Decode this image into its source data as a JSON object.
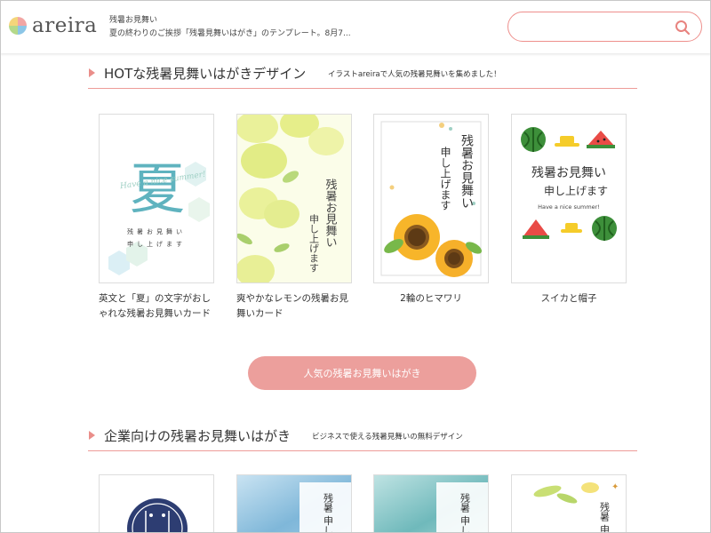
{
  "header": {
    "logo_text": "areira",
    "page_title": "残暑お見舞い",
    "page_desc": "夏の終わりのご挨拶「残暑見舞いはがき」のテンプレート。8月7...",
    "search_placeholder": ""
  },
  "hot_section": {
    "title": "HOTな残暑見舞いはがきデザイン",
    "subtitle": "イラストareiraで人気の残暑見舞いを集めました！",
    "cards": [
      {
        "caption": "英文と「夏」の文字がおしゃれな残暑お見舞いカード",
        "card_text": "残暑お見舞い",
        "card_text2": "申し上げます",
        "big_char": "夏",
        "script_text": "Have a nice summer!"
      },
      {
        "caption": "爽やかなレモンの残暑お見舞いカード",
        "card_text": "残暑お見舞い",
        "card_text2": "申し上げます"
      },
      {
        "caption": "2輪のヒマワリ",
        "card_text": "残暑お見舞い",
        "card_text2": "申し上げます"
      },
      {
        "caption": "スイカと帽子",
        "card_text": "残暑お見舞い",
        "card_text2": "申し上げます",
        "script_text": "Have a nice summer!"
      }
    ],
    "cta_label": "人気の残暑お見舞いはがき"
  },
  "business_section": {
    "title": "企業向けの残暑お見舞いはがき",
    "subtitle": "ビジネスで使える残暑見舞いの無料デザイン",
    "cards": [
      {
        "text": ""
      },
      {
        "text": "残暑 申し お見"
      },
      {
        "text": "残暑 申し お見"
      },
      {
        "text": "残暑 申"
      }
    ]
  },
  "colors": {
    "accent": "#ee8f8c",
    "button": "#ec9f9c"
  }
}
